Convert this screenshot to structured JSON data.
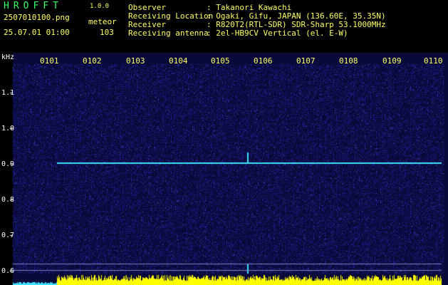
{
  "header": {
    "app_name": "HROFFT",
    "version": "1.0.0",
    "filename": "2507010100.png",
    "datetime": "25.07.01 01:00",
    "meteor_label": "meteor",
    "meteor_count": "103",
    "labels": {
      "observer": "Observer",
      "location": "Receiving Location",
      "receiver": "Receiver",
      "antenna": "Receiving antenna"
    },
    "values": {
      "observer": ": Takanori Kawachi",
      "location": ": Ogaki, Gifu, JAPAN (136.60E, 35.35N)",
      "receiver": ": R820T2(RTL-SDR) SDR-Sharp 53.1000MHz",
      "antenna": ": 2el-HB9CV Vertical (el. E-W)"
    }
  },
  "waterfall": {
    "unit_label": "kHz",
    "freq_ticks": [
      "1.1",
      "1.0",
      "0.9",
      "0.8",
      "0.7",
      "0.6"
    ],
    "time_ticks": [
      "0101",
      "0102",
      "0103",
      "0104",
      "0105",
      "0106",
      "0107",
      "0108",
      "0109",
      "0110"
    ],
    "colors": {
      "background": "#0a0a3a",
      "carrier": "#40e0ff",
      "power_bar": "#ffff00",
      "axis_text": "#ffff66"
    }
  }
}
